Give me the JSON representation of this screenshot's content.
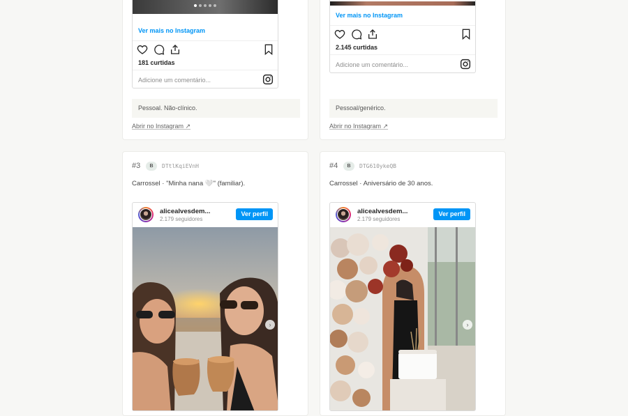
{
  "cards_top": [
    {
      "see_more": "Ver mais no Instagram",
      "likes": "181 curtidas",
      "comment_placeholder": "Adicione um comentário...",
      "note": "Pessoal. Não-clínico.",
      "open_link": "Abrir no Instagram ↗"
    },
    {
      "see_more": "Ver mais no Instagram",
      "likes": "2.145 curtidas",
      "comment_placeholder": "Adicione um comentário...",
      "note": "Pessoal/genérico.",
      "open_link": "Abrir no Instagram ↗"
    }
  ],
  "cards_bottom": [
    {
      "index": "#3",
      "type": "B",
      "code": "DTtlKqiEVnH",
      "description": "Carrossel · \"Minha nana 🤍\" (familiar).",
      "username": "alicealvesdem...",
      "followers": "2.179 seguidores",
      "view_profile": "Ver perfil"
    },
    {
      "index": "#4",
      "type": "B",
      "code": "DTG610ykeQB",
      "description": "Carrossel · Aniversário de 30 anos.",
      "username": "alicealvesdem...",
      "followers": "2.179 seguidores",
      "view_profile": "Ver perfil"
    }
  ],
  "icons": {
    "like": "heart-icon",
    "comment": "comment-icon",
    "share": "share-icon",
    "save": "bookmark-icon",
    "instagram": "instagram-icon",
    "next": "chevron-right-icon"
  },
  "colors": {
    "accent": "#0095f6",
    "background": "#f7f7f5",
    "note_bg": "#f6f6f2"
  }
}
